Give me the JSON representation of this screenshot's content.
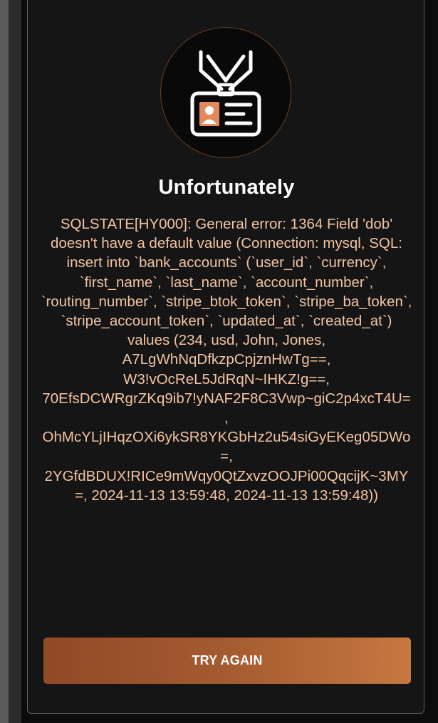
{
  "dialog": {
    "icon": "id-badge-icon",
    "title": "Unfortunately",
    "message": "SQLSTATE[HY000]: General error: 1364 Field 'dob' doesn't have a default value (Connection: mysql, SQL: insert into `bank_accounts` (`user_id`, `currency`, `first_name`, `last_name`, `account_number`, `routing_number`, `stripe_btok_token`, `stripe_ba_token`, `stripe_account_token`, `updated_at`, `created_at`) values (234, usd, John, Jones, A7LgWhNqDfkzpCpjznHwTg==, W3!vOcReL5JdRqN~IHKZ!g==, 70EfsDCWRgrZKq9ib7!yNAF2F8C3Vwp~giC2p4xcT4U=, OhMcYLjIHqzOXi6ykSR8YKGbHz2u54siGyEKeg05DWo=, 2YGfdBDUX!RICe9mWqy0QtZxvzOOJPi00QqcijK~3MY=, 2024-11-13 13:59:48, 2024-11-13 13:59:48))",
    "button_label": "TRY AGAIN"
  },
  "colors": {
    "accent": "#b86a38",
    "message_text": "#f2c3a2",
    "card_background": "#151515"
  }
}
